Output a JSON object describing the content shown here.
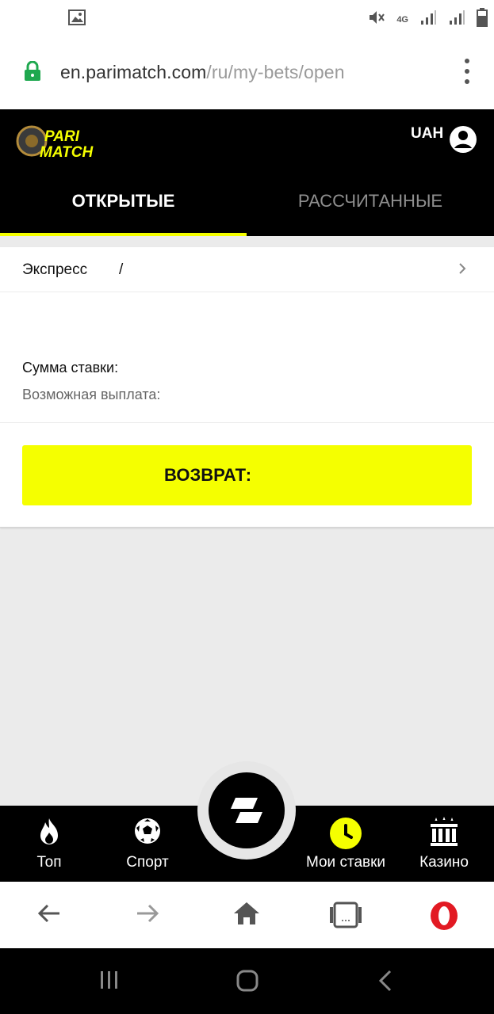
{
  "url_bar": {
    "host": "en.parimatch.com",
    "path": "/ru/my-bets/open"
  },
  "status_bar": {
    "network": "4G"
  },
  "header": {
    "logo_line1": "PARI",
    "logo_line2": "MATCH",
    "currency": "UAH"
  },
  "tabs": {
    "open": "ОТКРЫТЫЕ",
    "settled": "РАССЧИТАННЫЕ"
  },
  "bet": {
    "type": "Экспресс",
    "separator": "/",
    "stake_label": "Сумма ставки:",
    "payout_label": "Возможная выплата:",
    "return_button": "ВОЗВРАТ:"
  },
  "bottom_nav": [
    {
      "label": "Топ",
      "icon": "flame-icon"
    },
    {
      "label": "Спорт",
      "icon": "soccer-ball-icon"
    },
    {
      "label": "",
      "icon": "parimatch-logo-icon"
    },
    {
      "label": "Мои ставки",
      "icon": "clock-icon"
    },
    {
      "label": "Казино",
      "icon": "casino-icon"
    }
  ],
  "colors": {
    "accent": "#f5ff00",
    "header_bg": "#000000",
    "page_bg": "#ebebeb",
    "lock_green": "#1fa84f",
    "opera_red": "#e21a23"
  }
}
